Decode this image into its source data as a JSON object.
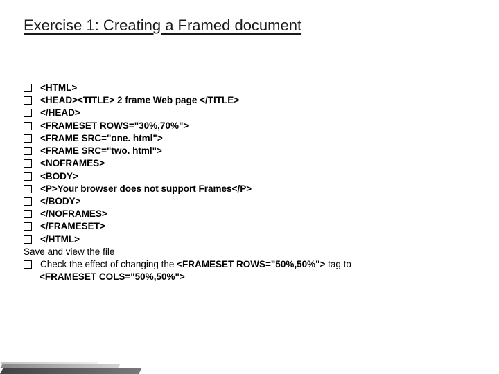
{
  "title": "Exercise 1: Creating a Framed document",
  "lines": [
    {
      "bullet": true,
      "bold": true,
      "text": "<HTML>"
    },
    {
      "bullet": true,
      "bold": true,
      "text": "<HEAD><TITLE> 2 frame Web page </TITLE>"
    },
    {
      "bullet": true,
      "bold": true,
      "text": "</HEAD>"
    },
    {
      "bullet": true,
      "bold": true,
      "text": "<FRAMESET ROWS=\"30%,70%\">"
    },
    {
      "bullet": true,
      "bold": true,
      "text": "<FRAME SRC=\"one. html\">"
    },
    {
      "bullet": true,
      "bold": true,
      "text": "<FRAME SRC=\"two. html\">"
    },
    {
      "bullet": true,
      "bold": true,
      "text": "<NOFRAMES>"
    },
    {
      "bullet": true,
      "bold": true,
      "text": "<BODY>"
    },
    {
      "bullet": true,
      "bold": true,
      "text": "<P>Your browser does not support Frames</P>"
    },
    {
      "bullet": true,
      "bold": true,
      "text": "</BODY>"
    },
    {
      "bullet": true,
      "bold": true,
      "text": "</NOFRAMES>"
    },
    {
      "bullet": true,
      "bold": true,
      "text": "</FRAMESET>"
    },
    {
      "bullet": true,
      "bold": true,
      "text": "</HTML>"
    },
    {
      "bullet": false,
      "bold": false,
      "text": "Save and view the file"
    },
    {
      "bullet": true,
      "bold": false,
      "richParts": [
        {
          "t": "Check the effect of changing the ",
          "b": false
        },
        {
          "t": "<FRAMESET ROWS=\"50%,50%\">",
          "b": true
        },
        {
          "t": " tag to ",
          "b": false
        }
      ]
    },
    {
      "bullet": false,
      "bold": false,
      "continuation": true,
      "richParts": [
        {
          "t": "<FRAMESET COLS=\"50%,50%\">",
          "b": true
        }
      ]
    }
  ]
}
